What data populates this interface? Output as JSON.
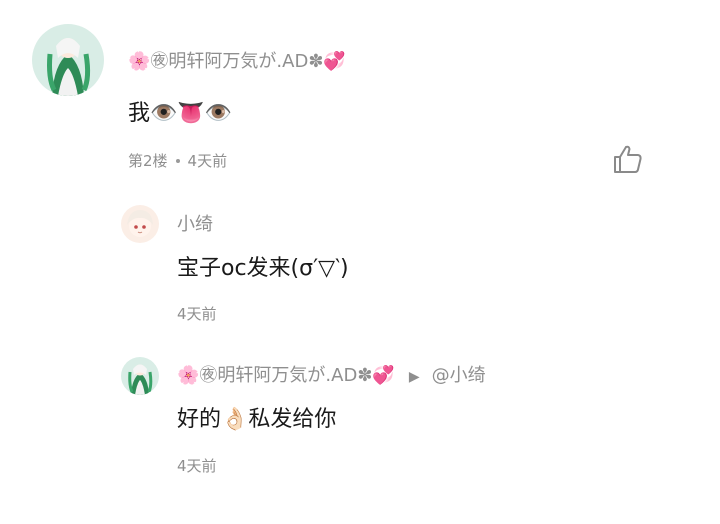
{
  "main_comment": {
    "username_prefix": "🌸",
    "username": "㊰明轩阿万気が.AD✽💞",
    "content": "我👁️👅👁️",
    "floor": "第2楼",
    "time": "4天前"
  },
  "replies": [
    {
      "username": "小绮",
      "content": "宝子oc发来(σ′▽‵)",
      "time": "4天前"
    },
    {
      "username_prefix": "🌸",
      "username": "㊰明轩阿万気が.AD✽💞",
      "reply_to": "@小绮",
      "content": "好的👌🏻私发给你",
      "time": "4天前"
    }
  ],
  "icons": {
    "like": "thumbs-up-icon",
    "reply_arrow": "play-triangle-icon"
  },
  "colors": {
    "meta_text": "#8f8f8f",
    "content_text": "#1a1a1a",
    "avatar_bg_main": "#d9ede6",
    "avatar_bg_reply": "#fbeee6"
  }
}
